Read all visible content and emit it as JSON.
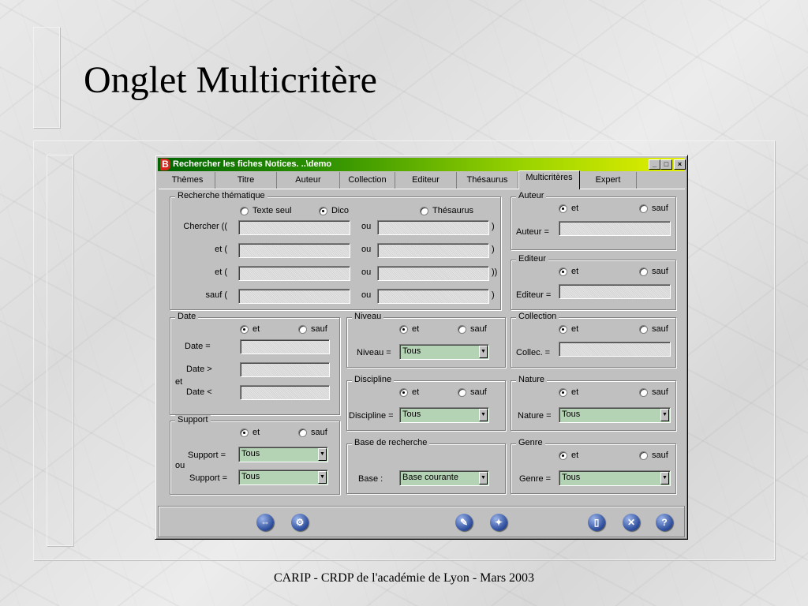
{
  "slide": {
    "title": "Onglet Multicritère",
    "footer": "CARIP - CRDP de l'académie de Lyon - Mars 2003"
  },
  "window": {
    "title": "Rechercher les fiches Notices. ..\\demo",
    "app_icon_letter": "B",
    "minimize": "_",
    "maximize": "□",
    "close": "×"
  },
  "tabs": [
    "Thèmes",
    "Titre",
    "Auteur",
    "Collection",
    "Editeur",
    "Thésaurus",
    "Multicritères",
    "Expert"
  ],
  "active_tab": "Multicritères",
  "common": {
    "et": "et",
    "sauf": "sauf",
    "ou": "ou",
    "tous": "Tous"
  },
  "recherche_thematique": {
    "title": "Recherche thématique",
    "options": [
      "Texte seul",
      "Dico",
      "Thésaurus"
    ],
    "selected": "Dico",
    "rows": [
      {
        "left": "Chercher ((",
        "mid": "ou",
        "right": ")"
      },
      {
        "left": "et (",
        "mid": "ou",
        "right": ")"
      },
      {
        "left": "et (",
        "mid": "ou",
        "right": "))"
      },
      {
        "left": "sauf (",
        "mid": "ou",
        "right": ")"
      }
    ]
  },
  "auteur": {
    "title": "Auteur",
    "field_label": "Auteur =",
    "selected": "et"
  },
  "editeur": {
    "title": "Editeur",
    "field_label": "Editeur =",
    "selected": "et"
  },
  "date": {
    "title": "Date",
    "labels": [
      "Date =",
      "Date >",
      "et",
      "Date <"
    ],
    "selected": "et"
  },
  "niveau": {
    "title": "Niveau",
    "field_label": "Niveau =",
    "value": "Tous",
    "selected": "et"
  },
  "collection": {
    "title": "Collection",
    "field_label": "Collec. =",
    "selected": "et"
  },
  "discipline": {
    "title": "Discipline",
    "field_label": "Discipline =",
    "value": "Tous",
    "selected": "et"
  },
  "nature": {
    "title": "Nature",
    "field_label": "Nature =",
    "value": "Tous",
    "selected": "et"
  },
  "support": {
    "title": "Support",
    "field_label": "Support =",
    "or_label": "ou",
    "value1": "Tous",
    "value2": "Tous",
    "selected": "et"
  },
  "base_recherche": {
    "title": "Base de recherche",
    "field_label": "Base :",
    "value": "Base courante"
  },
  "genre": {
    "title": "Genre",
    "field_label": "Genre =",
    "value": "Tous",
    "selected": "et"
  },
  "toolbar_icons": [
    "link-icon",
    "settings-gear-icon",
    "search-pencil-icon",
    "search-star-icon",
    "clear-document-icon",
    "close-x-icon",
    "help-question-icon"
  ],
  "colors": {
    "titlebar_start": "#006400",
    "titlebar_end": "#e6f000",
    "window_face": "#c0c0c0",
    "select_bg": "#b4d2b4",
    "icon_blue": "#2a4a9a"
  }
}
